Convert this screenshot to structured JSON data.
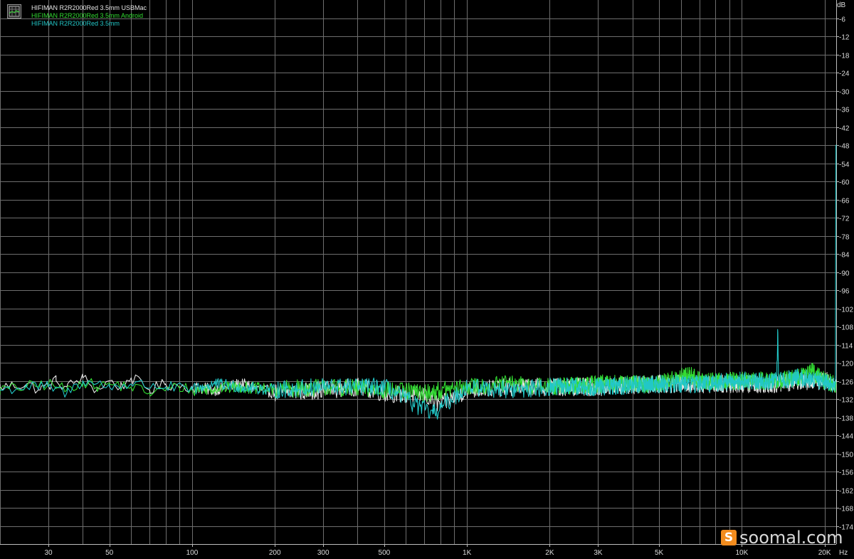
{
  "chart_data": {
    "type": "line",
    "title": "",
    "xlabel": "Hz",
    "ylabel": "dB",
    "x_scale": "log",
    "xlim": [
      20,
      22050
    ],
    "ylim": [
      -180,
      0
    ],
    "grid": true,
    "legend_position": "top-left",
    "x_ticks": [
      {
        "value": 30,
        "label": "30"
      },
      {
        "value": 50,
        "label": "50"
      },
      {
        "value": 100,
        "label": "100"
      },
      {
        "value": 200,
        "label": "200"
      },
      {
        "value": 300,
        "label": "300"
      },
      {
        "value": 500,
        "label": "500"
      },
      {
        "value": 1000,
        "label": "1K"
      },
      {
        "value": 2000,
        "label": "2K"
      },
      {
        "value": 3000,
        "label": "3K"
      },
      {
        "value": 5000,
        "label": "5K"
      },
      {
        "value": 10000,
        "label": "10K"
      },
      {
        "value": 20000,
        "label": "20K"
      }
    ],
    "y_ticks": [
      -6,
      -12,
      -18,
      -24,
      -30,
      -36,
      -42,
      -48,
      -54,
      -60,
      -66,
      -72,
      -78,
      -84,
      -90,
      -96,
      -102,
      -108,
      -114,
      -120,
      -126,
      -132,
      -138,
      -144,
      -150,
      -156,
      -162,
      -168,
      -174
    ],
    "series": [
      {
        "name": "HIFIMAN R2R2000Red 3.5mm USBMac",
        "color": "#e6e6e6",
        "points": [
          [
            20,
            -128
          ],
          [
            25,
            -127
          ],
          [
            28,
            -129
          ],
          [
            32,
            -126
          ],
          [
            35,
            -128
          ],
          [
            40,
            -125
          ],
          [
            45,
            -129
          ],
          [
            50,
            -126
          ],
          [
            55,
            -128
          ],
          [
            60,
            -125
          ],
          [
            70,
            -129
          ],
          [
            80,
            -127
          ],
          [
            100,
            -128
          ],
          [
            120,
            -129
          ],
          [
            150,
            -127
          ],
          [
            200,
            -130
          ],
          [
            300,
            -129
          ],
          [
            400,
            -128
          ],
          [
            500,
            -130
          ],
          [
            700,
            -131
          ],
          [
            800,
            -134
          ],
          [
            1000,
            -129
          ],
          [
            1500,
            -128
          ],
          [
            2000,
            -128
          ],
          [
            3000,
            -128
          ],
          [
            5000,
            -127
          ],
          [
            7000,
            -127
          ],
          [
            10000,
            -127
          ],
          [
            13500,
            -127
          ],
          [
            16000,
            -126
          ],
          [
            20000,
            -126
          ],
          [
            22050,
            -127
          ]
        ]
      },
      {
        "name": "HIFIMAN R2R2000Red 3.5mm Android",
        "color": "#33dd33",
        "points": [
          [
            20,
            -129
          ],
          [
            25,
            -128
          ],
          [
            30,
            -127
          ],
          [
            35,
            -129
          ],
          [
            40,
            -126
          ],
          [
            45,
            -128
          ],
          [
            50,
            -127
          ],
          [
            60,
            -128
          ],
          [
            70,
            -130
          ],
          [
            90,
            -128
          ],
          [
            100,
            -129
          ],
          [
            150,
            -128
          ],
          [
            200,
            -129
          ],
          [
            300,
            -128
          ],
          [
            500,
            -129
          ],
          [
            700,
            -130
          ],
          [
            1000,
            -128
          ],
          [
            1500,
            -127
          ],
          [
            2000,
            -128
          ],
          [
            3000,
            -127
          ],
          [
            5000,
            -127
          ],
          [
            6500,
            -124
          ],
          [
            7000,
            -126
          ],
          [
            10000,
            -126
          ],
          [
            13500,
            -126
          ],
          [
            16000,
            -125
          ],
          [
            18000,
            -123
          ],
          [
            20000,
            -126
          ],
          [
            22050,
            -127
          ]
        ]
      },
      {
        "name": "HIFIMAN R2R2000Red 3.5mm",
        "color": "#22c7c7",
        "points": [
          [
            20,
            -129
          ],
          [
            25,
            -128
          ],
          [
            30,
            -128
          ],
          [
            35,
            -130
          ],
          [
            40,
            -126
          ],
          [
            50,
            -128
          ],
          [
            60,
            -127
          ],
          [
            80,
            -128
          ],
          [
            100,
            -129
          ],
          [
            120,
            -127
          ],
          [
            150,
            -128
          ],
          [
            200,
            -129
          ],
          [
            300,
            -128
          ],
          [
            500,
            -128
          ],
          [
            750,
            -137
          ],
          [
            1000,
            -128
          ],
          [
            1500,
            -129
          ],
          [
            2000,
            -128
          ],
          [
            3000,
            -128
          ],
          [
            5000,
            -127
          ],
          [
            7000,
            -127
          ],
          [
            10000,
            -126
          ],
          [
            13400,
            -126
          ],
          [
            13500,
            -109
          ],
          [
            13600,
            -126
          ],
          [
            16000,
            -125
          ],
          [
            20000,
            -126
          ],
          [
            21900,
            -127
          ],
          [
            22000,
            -48
          ],
          [
            22050,
            -48
          ]
        ]
      }
    ]
  },
  "legend": {
    "entries": [
      {
        "label": "HIFIMAN R2R2000Red 3.5mm USBMac",
        "color": "#e6e6e6"
      },
      {
        "label": "HIFIMAN R2R2000Red 3.5mm Android",
        "color": "#33dd33"
      },
      {
        "label": "HIFIMAN R2R2000Red 3.5mm",
        "color": "#22c7c7"
      }
    ]
  },
  "axis": {
    "y_unit": "dB",
    "x_unit": "Hz"
  },
  "watermark": {
    "logo_letter": "S",
    "text": "soomal.com"
  }
}
